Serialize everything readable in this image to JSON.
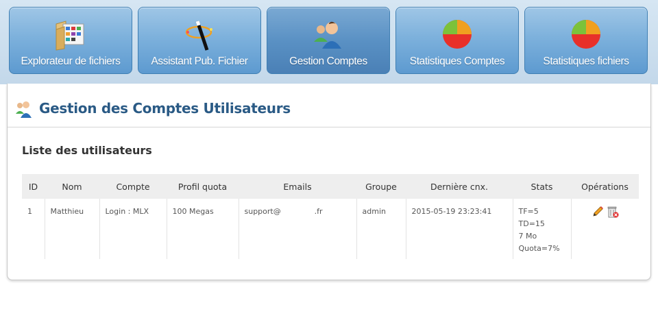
{
  "nav": {
    "tabs": [
      {
        "label": "Explorateur de fichiers",
        "icon": "folder-icon"
      },
      {
        "label": "Assistant Pub. Fichier",
        "icon": "magic-wand-icon"
      },
      {
        "label": "Gestion  Comptes",
        "icon": "users-icon",
        "active": true
      },
      {
        "label": "Statistiques Comptes",
        "icon": "pie-chart-icon"
      },
      {
        "label": "Statistiques fichiers",
        "icon": "pie-chart-icon"
      }
    ]
  },
  "page": {
    "title": "Gestion des Comptes Utilisateurs",
    "section_title": "Liste des utilisateurs"
  },
  "table": {
    "headers": [
      "ID",
      "Nom",
      "Compte",
      "Profil quota",
      "Emails",
      "Groupe",
      "Dernière cnx.",
      "Stats",
      "Opérations"
    ],
    "rows": [
      {
        "id": "1",
        "nom": "Matthieu",
        "compte": "Login : MLX",
        "quota": "100 Megas",
        "email": "support@              .fr",
        "groupe": "admin",
        "derniere": "2015-05-19 23:23:41",
        "stats": [
          "TF=5",
          "TD=15",
          "7 Mo",
          "Quota=7%"
        ],
        "ops": [
          "edit-icon",
          "delete-icon"
        ]
      }
    ]
  },
  "colors": {
    "tab_bg": "#7db1dc",
    "tab_active_bg": "#5a91c4",
    "title": "#2a5a85"
  }
}
